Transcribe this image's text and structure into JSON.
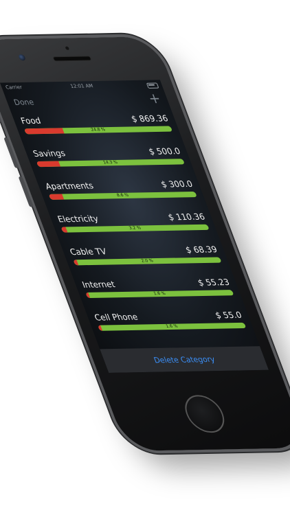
{
  "status": {
    "carrier": "Carrier",
    "time": "12:01 AM"
  },
  "nav": {
    "done_label": "Done",
    "add_label": "+"
  },
  "categories": [
    {
      "name": "Food",
      "amount": "$ 869.36",
      "percent_label": "24.8 %",
      "percent": 24.8
    },
    {
      "name": "Savings",
      "amount": "$ 500.0",
      "percent_label": "14.3 %",
      "percent": 14.3
    },
    {
      "name": "Apartments",
      "amount": "$ 300.0",
      "percent_label": "8.6 %",
      "percent": 8.6
    },
    {
      "name": "Electricity",
      "amount": "$ 110.36",
      "percent_label": "3.2 %",
      "percent": 3.2
    },
    {
      "name": "Cable TV",
      "amount": "$ 68.39",
      "percent_label": "2.0 %",
      "percent": 2.0
    },
    {
      "name": "Internet",
      "amount": "$ 55.23",
      "percent_label": "1.6 %",
      "percent": 1.6
    },
    {
      "name": "Cell Phone",
      "amount": "$ 55.0",
      "percent_label": "1.6 %",
      "percent": 1.6
    }
  ],
  "footer": {
    "delete_label": "Delete Category"
  },
  "colors": {
    "spent": "#d93a2e",
    "remaining": "#7cc13e",
    "accent": "#3b8ef5"
  }
}
